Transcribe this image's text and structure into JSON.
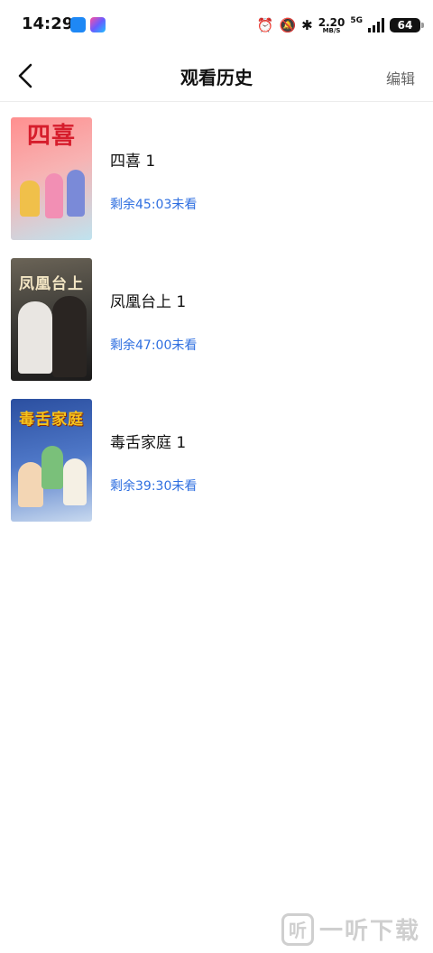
{
  "status_bar": {
    "time": "14:29",
    "net_speed_value": "2.20",
    "net_speed_unit": "MB/S",
    "network_type": "5G",
    "battery": "64"
  },
  "header": {
    "title": "观看历史",
    "edit_label": "编辑"
  },
  "history": [
    {
      "title": "四喜 1",
      "progress": "剩余45:03未看",
      "poster_text": "四喜"
    },
    {
      "title": "凤凰台上 1",
      "progress": "剩余47:00未看",
      "poster_text": "凤凰台上"
    },
    {
      "title": "毒舌家庭 1",
      "progress": "剩余39:30未看",
      "poster_text": "毒舌家庭"
    }
  ],
  "watermark": {
    "mark": "听",
    "text": "一听下载"
  },
  "colors": {
    "accent_blue": "#2f6fe0",
    "title_text": "#111111",
    "secondary_text": "#666666"
  }
}
